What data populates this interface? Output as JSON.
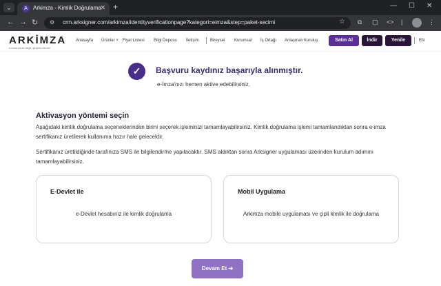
{
  "browser": {
    "tab_title": "Arkimza - Kimlik Doğrulama",
    "url": "crm.arksigner.com/arkimza/identityverificationpage?kategori=eimza&step=paket-secimi"
  },
  "site": {
    "logo_text": "ARKİMZA",
    "logo_tagline": "e-imza senin değil, şirketin elinde!",
    "nav": [
      "Anasayfa",
      "Ürünler ˅",
      "Fiyat Listesi",
      "Bilgi Deposu",
      "İletişim",
      "Bireysel",
      "Kurumsal",
      "İş Ortağı",
      "Anlaşmalı Kuruluş"
    ],
    "buttons": {
      "buy": "Satın Al",
      "download": "İndir",
      "renew": "Yenile"
    },
    "lang": "EN"
  },
  "success": {
    "title": "Başvuru kaydınız başarıyla alınmıştır.",
    "subtitle": "e-İmza'nızı hemen aktive edebilirsiniz."
  },
  "activation": {
    "title": "Aktivasyon yöntemi seçin",
    "para1": "Aşağıdaki kimlik doğrulama seçeneklerinden birini seçerek işleminizi tamamlayabilirsiniz. Kimlik doğrulama işlemi tamamlandıktan sonra e-imza sertifikanız üretilerek kullanıma hazır hale gelecektir.",
    "para2": "Sertifikanız üretildiğinde tarafınıza SMS ile bilgilendirme yapılacaktır. SMS aldıktan sonra Arksigner uygulaması üzerinden kurulum adımını tamamlayabilirsiniz."
  },
  "options": [
    {
      "title": "E-Devlet ile",
      "description": "e-Devlet hesabınız ile kimlik doğrulama"
    },
    {
      "title": "Mobil Uygulama",
      "description": "Arkimza mobile uygulaması ve çipli kimlik ile doğrulama"
    }
  ],
  "continue_label": "Devam Et ➔",
  "colors": {
    "brand": "#4a2c8a",
    "continue": "#8f72c4",
    "buy": "#5b2e9a",
    "dark_button": "#2a1538"
  }
}
